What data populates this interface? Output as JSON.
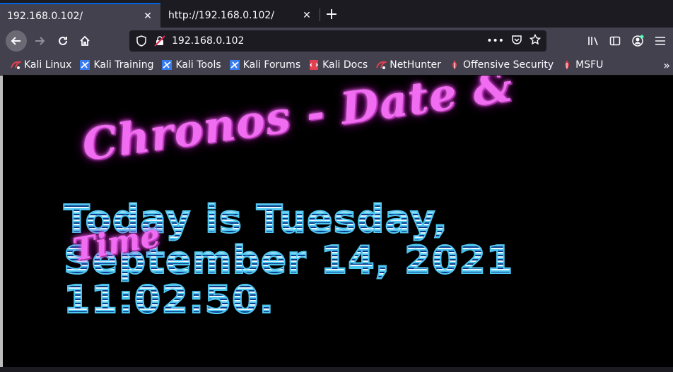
{
  "tabs": [
    {
      "label": "192.168.0.102/",
      "active": true
    },
    {
      "label": "http://192.168.0.102/",
      "active": false
    }
  ],
  "urlbar": {
    "url": "192.168.0.102"
  },
  "bookmarks": [
    {
      "label": "Kali Linux",
      "icon": "kali-dragon-icon"
    },
    {
      "label": "Kali Training",
      "icon": "kali-training-icon"
    },
    {
      "label": "Kali Tools",
      "icon": "kali-tools-icon"
    },
    {
      "label": "Kali Forums",
      "icon": "kali-forums-icon"
    },
    {
      "label": "Kali Docs",
      "icon": "kali-docs-icon"
    },
    {
      "label": "NetHunter",
      "icon": "nethunter-icon"
    },
    {
      "label": "Offensive Security",
      "icon": "offsec-icon"
    },
    {
      "label": "MSFU",
      "icon": "msfu-icon"
    }
  ],
  "page": {
    "title_line1": "Chronos - Date &",
    "title_line2": "Time",
    "date_line1": "Today is Tuesday,",
    "date_line2": "September 14, 2021",
    "date_line3": "11:02:50."
  },
  "colors": {
    "accent": "#0060df",
    "title_pink": "#f06cf0",
    "date_cyan": "#4ec7f0"
  }
}
